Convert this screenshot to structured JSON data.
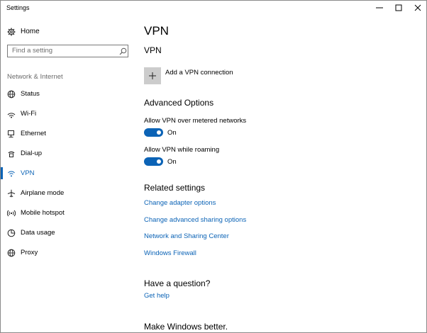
{
  "window": {
    "title": "Settings",
    "controls": {
      "minimize_icon": "minimize-icon",
      "maximize_icon": "maximize-icon",
      "close_icon": "close-icon"
    }
  },
  "sidebar": {
    "home": {
      "label": "Home",
      "icon": "gear-icon"
    },
    "search": {
      "placeholder": "Find a setting",
      "value": "",
      "icon": "search-icon"
    },
    "section_label": "Network & Internet",
    "items": [
      {
        "label": "Status",
        "icon": "globe-icon",
        "active": false
      },
      {
        "label": "Wi-Fi",
        "icon": "wifi-icon",
        "active": false
      },
      {
        "label": "Ethernet",
        "icon": "ethernet-icon",
        "active": false
      },
      {
        "label": "Dial-up",
        "icon": "dialup-icon",
        "active": false
      },
      {
        "label": "VPN",
        "icon": "vpn-icon",
        "active": true
      },
      {
        "label": "Airplane mode",
        "icon": "airplane-icon",
        "active": false
      },
      {
        "label": "Mobile hotspot",
        "icon": "hotspot-icon",
        "active": false
      },
      {
        "label": "Data usage",
        "icon": "pie-chart-icon",
        "active": false
      },
      {
        "label": "Proxy",
        "icon": "globe-icon",
        "active": false
      }
    ]
  },
  "main": {
    "title": "VPN",
    "vpn_heading": "VPN",
    "add_vpn": {
      "label": "Add a VPN connection",
      "icon": "plus-icon"
    },
    "advanced": {
      "heading": "Advanced Options",
      "options": [
        {
          "label": "Allow VPN over metered networks",
          "state": "On",
          "on": true
        },
        {
          "label": "Allow VPN while roaming",
          "state": "On",
          "on": true
        }
      ]
    },
    "related": {
      "heading": "Related settings",
      "links": [
        "Change adapter options",
        "Change advanced sharing options",
        "Network and Sharing Center",
        "Windows Firewall"
      ]
    },
    "question": {
      "heading": "Have a question?",
      "link": "Get help"
    },
    "feedback": {
      "heading": "Make Windows better."
    }
  },
  "colors": {
    "accent": "#0b63b6",
    "tile": "#cccccc",
    "muted_text": "#6b6b6b"
  }
}
